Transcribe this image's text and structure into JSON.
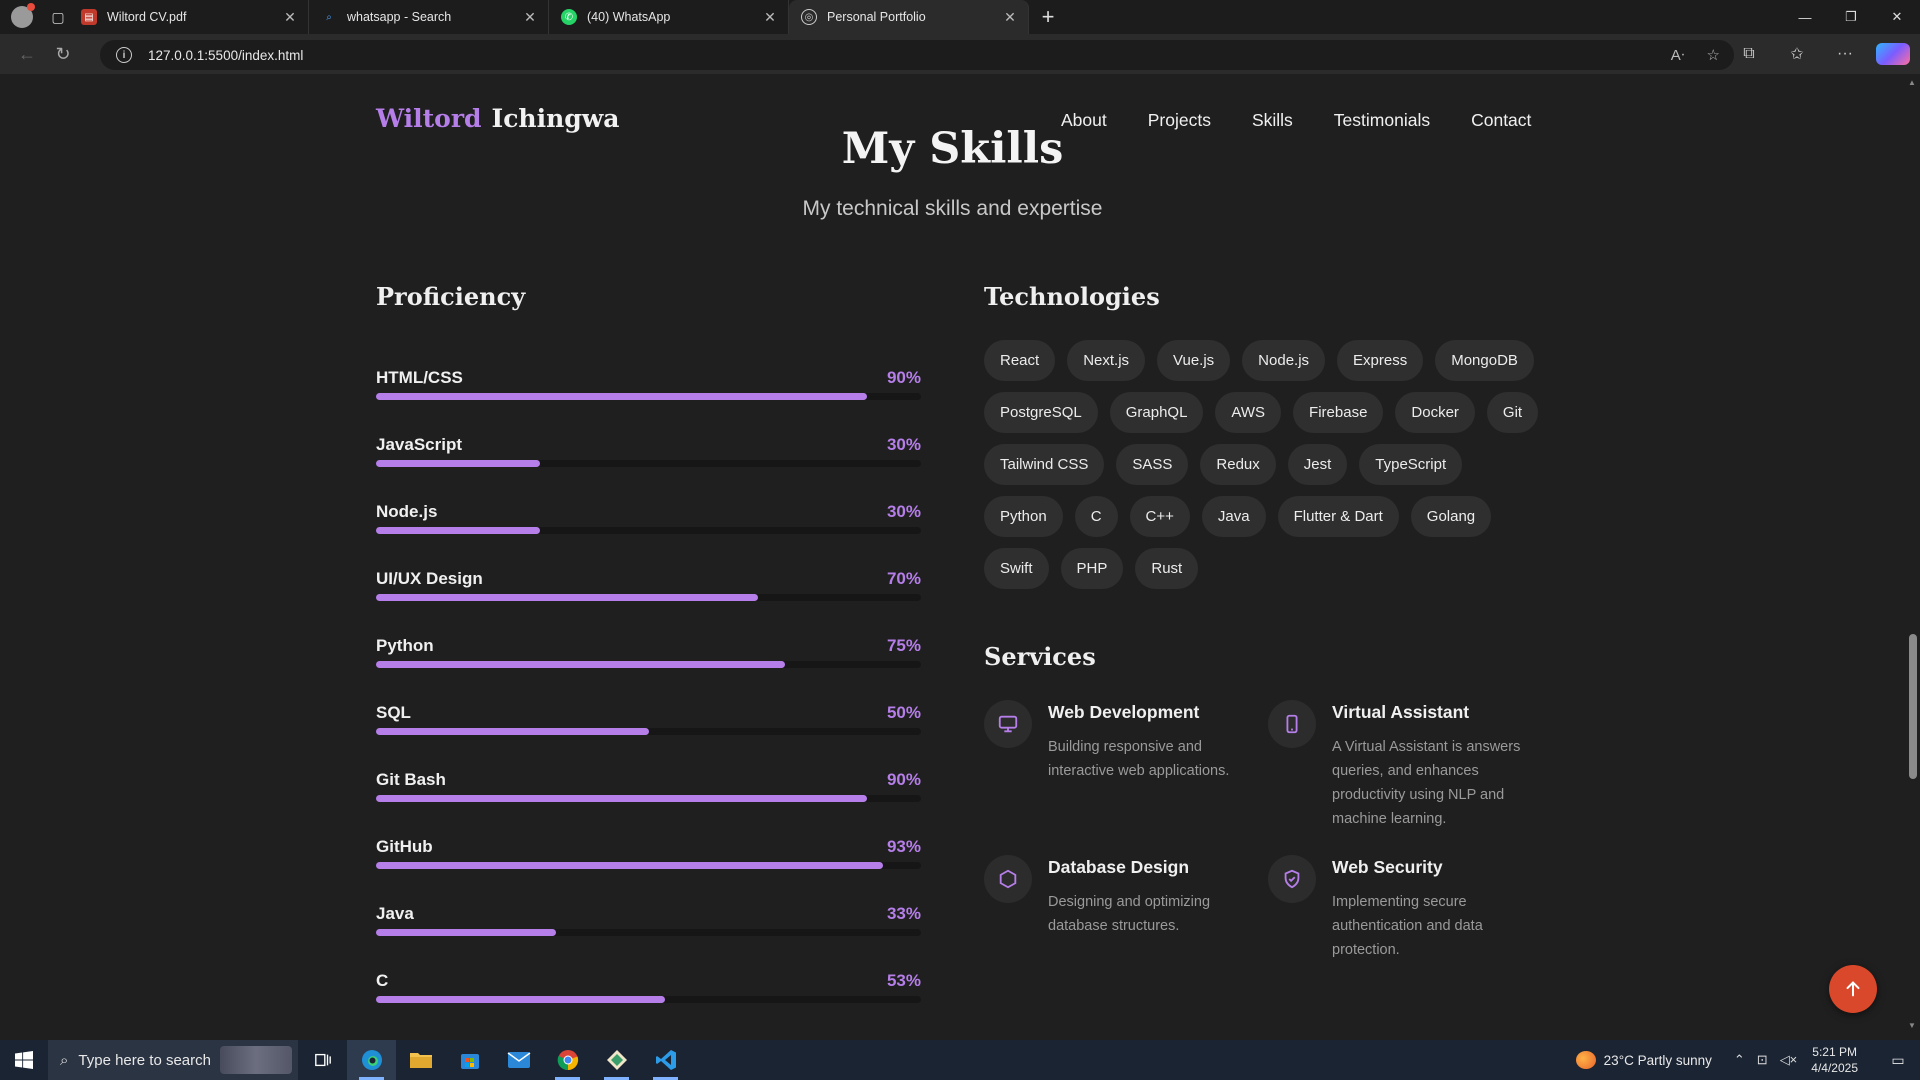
{
  "browser": {
    "tabs": [
      {
        "title": "Wiltord CV.pdf",
        "icon": "pdf-icon",
        "active": false
      },
      {
        "title": "whatsapp - Search",
        "icon": "search-icon",
        "active": false
      },
      {
        "title": "(40) WhatsApp",
        "icon": "whatsapp-icon",
        "active": false
      },
      {
        "title": "Personal Portfolio",
        "icon": "globe-icon",
        "active": true
      }
    ],
    "url": "127.0.0.1:5500/index.html"
  },
  "site": {
    "logo_first": "Wiltord",
    "logo_last": "Ichingwa",
    "nav": [
      "About",
      "Projects",
      "Skills",
      "Testimonials",
      "Contact"
    ],
    "accent": "#b57ee8"
  },
  "skills_section": {
    "title": "My Skills",
    "subtitle": "My technical skills and expertise",
    "proficiency_title": "Proficiency",
    "proficiency": [
      {
        "name": "HTML/CSS",
        "percent": 90
      },
      {
        "name": "JavaScript",
        "percent": 30
      },
      {
        "name": "Node.js",
        "percent": 30
      },
      {
        "name": "UI/UX Design",
        "percent": 70
      },
      {
        "name": "Python",
        "percent": 75
      },
      {
        "name": "SQL",
        "percent": 50
      },
      {
        "name": "Git Bash",
        "percent": 90
      },
      {
        "name": "GitHub",
        "percent": 93
      },
      {
        "name": "Java",
        "percent": 33
      },
      {
        "name": "C",
        "percent": 53
      }
    ],
    "technologies_title": "Technologies",
    "technologies": [
      "React",
      "Next.js",
      "Vue.js",
      "Node.js",
      "Express",
      "MongoDB",
      "PostgreSQL",
      "GraphQL",
      "AWS",
      "Firebase",
      "Docker",
      "Git",
      "Tailwind CSS",
      "SASS",
      "Redux",
      "Jest",
      "TypeScript",
      "Python",
      "C",
      "C++",
      "Java",
      "Flutter & Dart",
      "Golang",
      "Swift",
      "PHP",
      "Rust"
    ],
    "services_title": "Services",
    "services": [
      {
        "title": "Web Development",
        "description": "Building responsive and interactive web applications.",
        "icon": "monitor-icon"
      },
      {
        "title": "Virtual Assistant",
        "description": "A Virtual Assistant is answers queries, and enhances productivity using NLP and machine learning.",
        "icon": "smartphone-icon"
      },
      {
        "title": "Database Design",
        "description": "Designing and optimizing database structures.",
        "icon": "hexagon-icon"
      },
      {
        "title": "Web Security",
        "description": "Implementing secure authentication and data protection.",
        "icon": "shield-check-icon"
      }
    ]
  },
  "taskbar": {
    "search_placeholder": "Type here to search",
    "weather": "23°C  Partly sunny",
    "time": "5:21 PM",
    "date": "4/4/2025"
  }
}
